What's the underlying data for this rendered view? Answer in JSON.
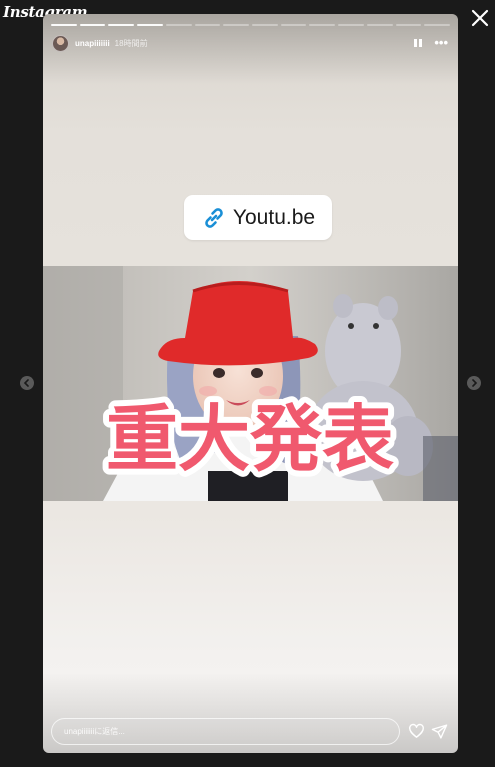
{
  "brand": {
    "logo": "Instagram"
  },
  "window": {
    "close_icon": "close-icon"
  },
  "story": {
    "progress_total": 14,
    "progress_done": 4,
    "user": {
      "username": "unapiiiiiii",
      "time": "18時間前"
    },
    "controls": {
      "pause_icon": "pause-icon",
      "more_icon": "more-horizontal-icon",
      "more_label": "•••"
    },
    "link_sticker": {
      "icon": "link-icon",
      "text": "Youtu.be"
    },
    "photo": {
      "overlay_text": "重大発表",
      "overlay_color": "#f0596e"
    },
    "reply": {
      "placeholder": "unapiiiiiiiに返信...",
      "heart_icon": "heart-icon",
      "send_icon": "send-icon"
    }
  },
  "navigation": {
    "prev_icon": "chevron-left-icon",
    "next_icon": "chevron-right-icon"
  },
  "colors": {
    "background": "#1a1a1a",
    "link_blue": "#1a8fd6",
    "hat_red": "#e02a2a"
  }
}
